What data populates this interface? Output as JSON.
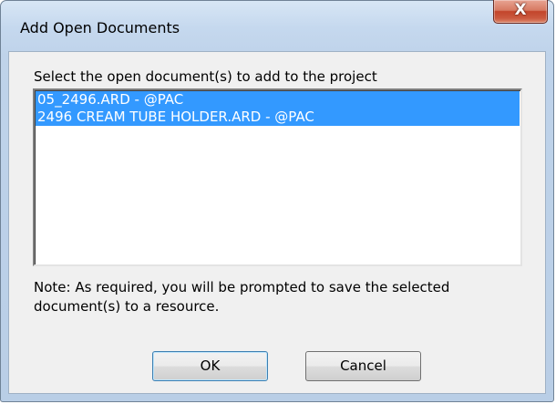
{
  "window": {
    "title": "Add Open Documents",
    "close_glyph": "X"
  },
  "dialog": {
    "instruction": "Select the open document(s) to add to the project",
    "documents": [
      {
        "label": "05_2496.ARD - @PAC",
        "selected": true
      },
      {
        "label": "2496 CREAM TUBE HOLDER.ARD - @PAC",
        "selected": true
      }
    ],
    "note": "Note: As required, you will be prompted to save the selected document(s) to a resource."
  },
  "buttons": {
    "ok_label": "OK",
    "cancel_label": "Cancel"
  },
  "colors": {
    "selection": "#3399ff",
    "close_button": "#c3452b",
    "dialog_background": "#f0f0f0"
  },
  "icons": {
    "close": "close-icon"
  }
}
